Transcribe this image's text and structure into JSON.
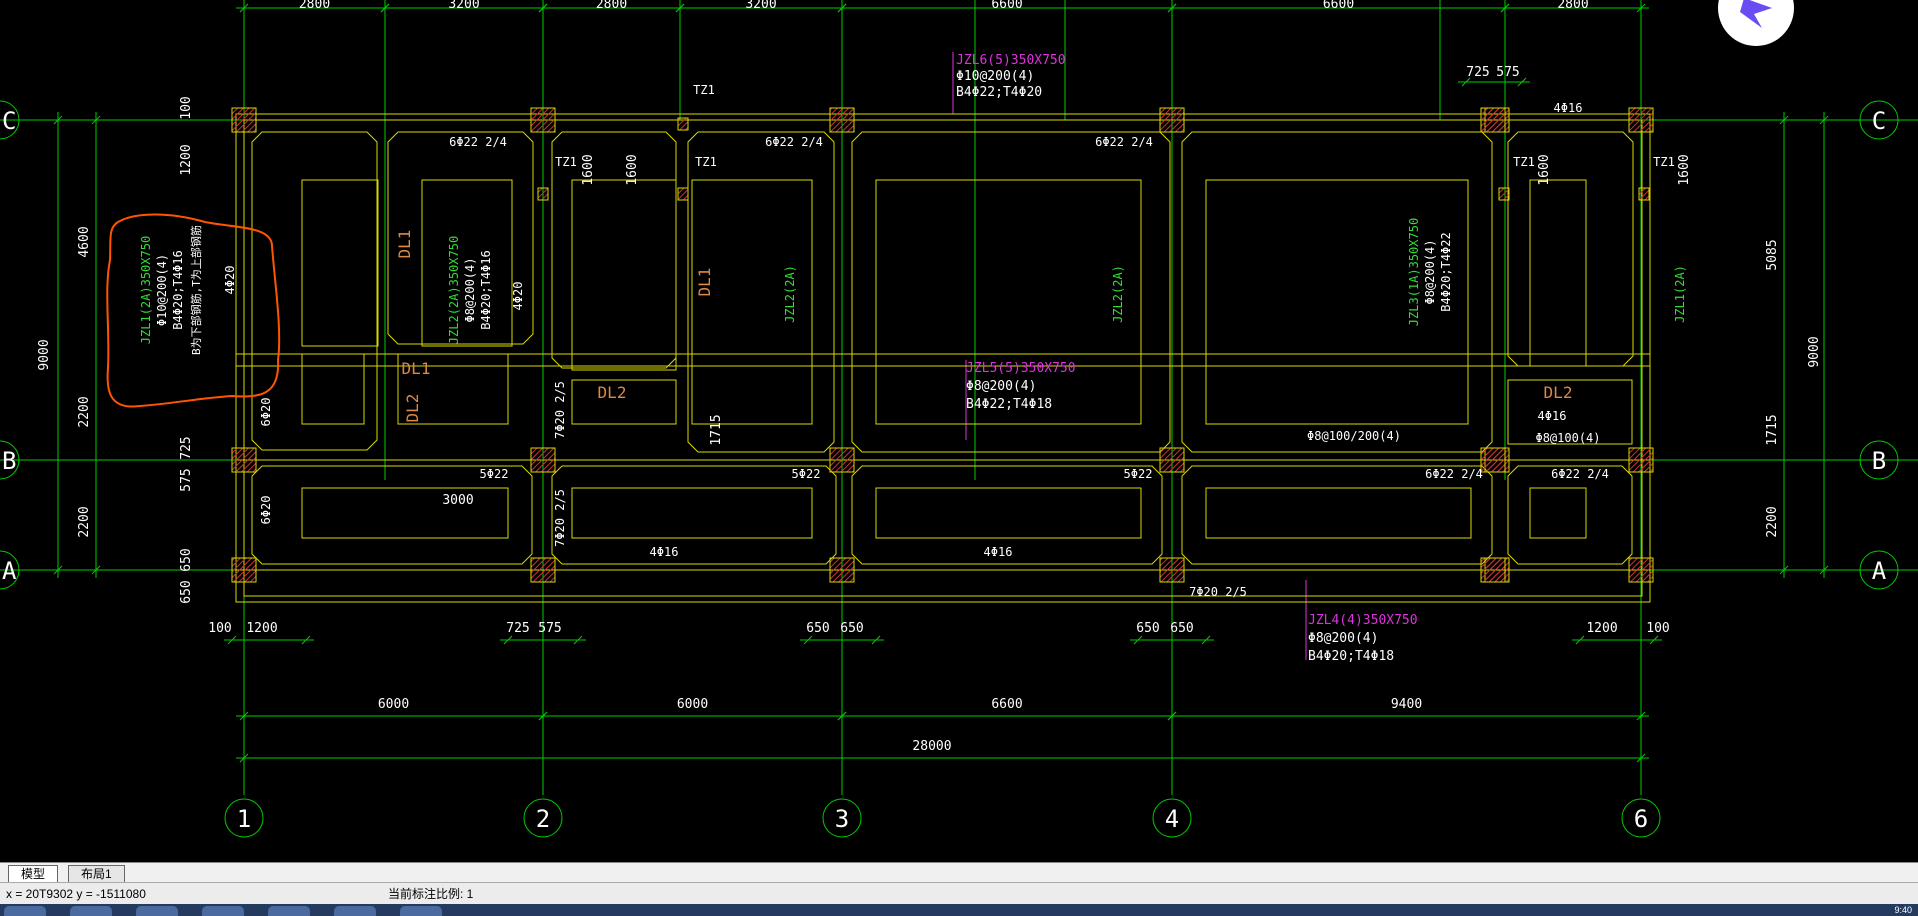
{
  "colors": {
    "background": "#000000",
    "grid": "#00cc00",
    "beam": "#d8d800",
    "column": "#cc3333",
    "label_green": "#33dd33",
    "label_magenta": "#dd33dd",
    "label_white": "#ffffff",
    "label_orange": "#dd8844",
    "markup": "#ff5500"
  },
  "dims_top": [
    "2800",
    "3200",
    "2800",
    "3200",
    "6600",
    "6600",
    "2800"
  ],
  "dims_bottom_segments": [
    "6000",
    "6000",
    "6600",
    "9400"
  ],
  "dim_total": "28000",
  "dims_bottom_small": [
    "100",
    "1200",
    "725",
    "575",
    "650",
    "650",
    "650",
    "650",
    "1200",
    "100"
  ],
  "dims_left": [
    "100",
    "1200",
    "4600",
    "9000",
    "2200",
    "725",
    "575",
    "2200",
    "650",
    "650"
  ],
  "dims_right": [
    "5085",
    "9000",
    "1715",
    "2200"
  ],
  "dims_top_small": [
    "725",
    "575",
    "1600",
    "1600",
    "1600",
    "1600"
  ],
  "dim_3000": "3000",
  "dim_1715": "1715",
  "grid_axes_bottom": [
    "1",
    "2",
    "3",
    "4",
    "6"
  ],
  "grid_axes_side": [
    "C",
    "B",
    "A"
  ],
  "beams": {
    "jzl6": {
      "name": "JZL6(5)350X750",
      "stirrup": "Φ10@200(4)",
      "bars": "B4Φ22;T4Φ20"
    },
    "jzl5": {
      "name": "JZL5(5)350X750",
      "stirrup": "Φ8@200(4)",
      "bars": "B4Φ22;T4Φ18"
    },
    "jzl4": {
      "name": "JZL4(4)350X750",
      "stirrup": "Φ8@200(4)",
      "bars": "B4Φ20;T4Φ18"
    },
    "jzl1": {
      "name": "JZL1(2A)350X750",
      "stirrup": "Φ10@200(4)",
      "bars": "B4Φ20;T4Φ16",
      "note": "B为下部钢筋,T为上部钢筋"
    },
    "jzl2": {
      "name": "JZL2(2A)350X750",
      "stirrup": "Φ8@200(4)",
      "bars": "B4Φ20;T4Φ16"
    },
    "jzl3": {
      "name": "JZL3(1A)350X750",
      "stirrup": "Φ8@200(4)",
      "bars": "B4Φ20;T4Φ22"
    },
    "jzl2_short": "JZL2(2A)",
    "jzl1_short": "JZL1(2A)"
  },
  "labels": {
    "dl1": "DL1",
    "dl2": "DL2",
    "tz1": "TZ1",
    "r6_22_24": "6Φ22 2/4",
    "r4_16": "4Φ16",
    "r4_20": "4Φ20",
    "r6_20": "6Φ20",
    "r5_22": "5Φ22",
    "r7_20_25": "7Φ20 2/5",
    "r8_100_200": "Φ8@100/200(4)",
    "r8_100": "Φ8@100(4)"
  },
  "tabs": [
    {
      "label": "模型",
      "active": true
    },
    {
      "label": "布局1",
      "active": false
    }
  ],
  "status": {
    "coords": "x = 20T9302  y = -1511080",
    "scale": "当前标注比例: 1"
  },
  "clock": "9:40"
}
